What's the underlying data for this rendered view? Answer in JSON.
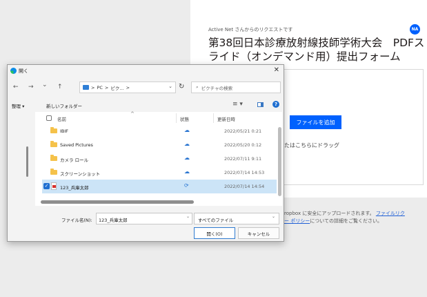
{
  "page": {
    "request_label": "Active Net さんからのリクエストです",
    "avatar_initials": "NA",
    "form_title": "第38回日本診療放射線技師学術大会　PDFスライド（オンデマンド用）提出フォーム",
    "add_file_button": "ファイルを追加",
    "drag_text": "たはこちらにドラッグ",
    "footer_prefix": "ropbox に安全にアップロードされます。",
    "footer_link1": "ファイルリク",
    "footer_link2": "ー ポリシー",
    "footer_suffix": "についての詳細をご覧ください。"
  },
  "dialog": {
    "title": "開く",
    "close": "✕",
    "nav": {
      "back": "←",
      "forward": "→",
      "history": "⌄",
      "up": "↑",
      "path": [
        "PC",
        "ピク..."
      ],
      "path_sep": ">",
      "refresh": "↻",
      "search_placeholder": "ピクチャの検索",
      "search_icon": "⌕"
    },
    "commands": {
      "organize": "整理 ▾",
      "new_folder": "新しいフォルダー",
      "view_icon": "≡ ▾",
      "help": "?"
    },
    "columns": {
      "name": "名前",
      "status": "状態",
      "date": "更新日時"
    },
    "files": [
      {
        "name": "IBIF",
        "type": "folder",
        "date": "2022/05/21 0:21",
        "status_icon": "☁",
        "selected": false
      },
      {
        "name": "Saved Pictures",
        "type": "folder",
        "date": "2022/05/20 0:12",
        "status_icon": "☁",
        "selected": false
      },
      {
        "name": "カメラ ロール",
        "type": "folder",
        "date": "2022/07/11 9:11",
        "status_icon": "☁",
        "selected": false
      },
      {
        "name": "スクリーンショット",
        "type": "folder",
        "date": "2022/07/14 14:53",
        "status_icon": "☁",
        "selected": false
      },
      {
        "name": "123_兵庫太郎",
        "type": "pdf",
        "date": "2022/07/14 14:54",
        "status_icon": "⟳",
        "selected": true
      }
    ],
    "filename_label": "ファイル名(N):",
    "filename_value": "123_兵庫太郎",
    "filetype_value": "すべてのファイル",
    "open_button": "開く(O)",
    "cancel_button": "キャンセル"
  }
}
